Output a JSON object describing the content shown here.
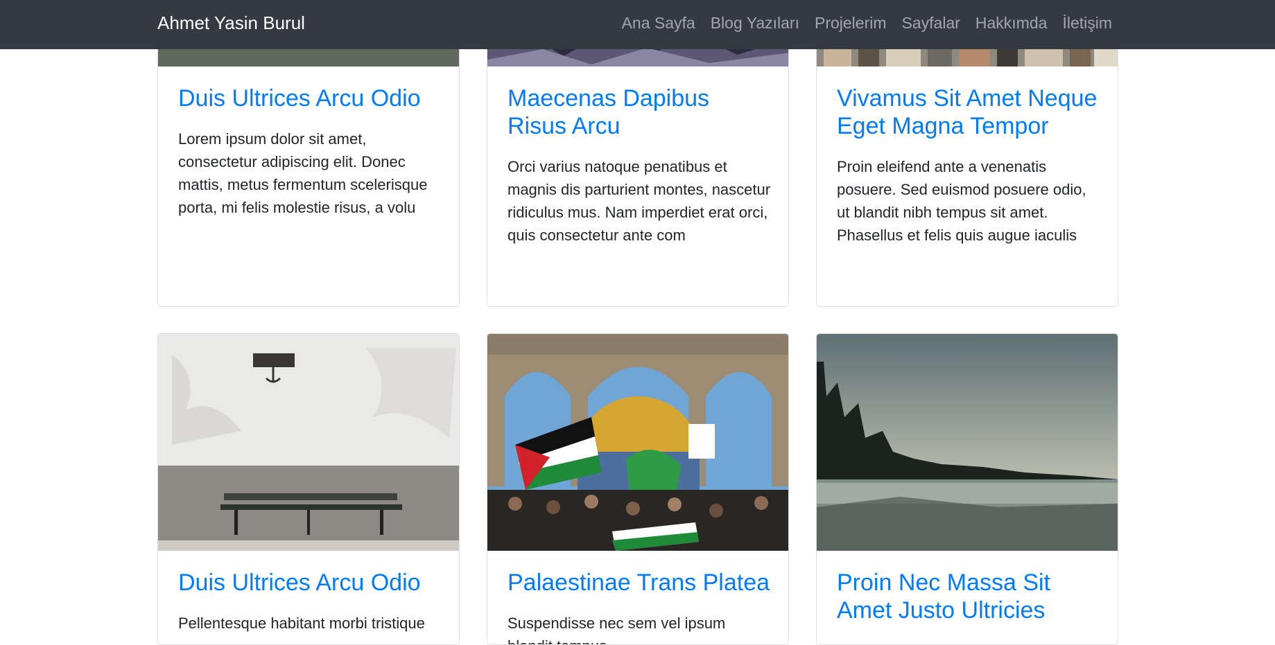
{
  "brand": "Ahmet Yasin Burul",
  "nav": [
    {
      "label": "Ana Sayfa"
    },
    {
      "label": "Blog Yazıları"
    },
    {
      "label": "Projelerim"
    },
    {
      "label": "Sayfalar"
    },
    {
      "label": "Hakkımda"
    },
    {
      "label": "İletişim"
    }
  ],
  "posts": [
    {
      "title": "Duis Ultrices Arcu Odio",
      "excerpt": "Lorem ipsum dolor sit amet, consectetur adipiscing elit. Donec mattis, metus fermentum scelerisque porta, mi felis molestie risus, a volu"
    },
    {
      "title": "Maecenas Dapibus Risus Arcu",
      "excerpt": "Orci varius natoque penatibus et magnis dis parturient montes, nascetur ridiculus mus. Nam imperdiet erat orci, quis consectetur ante com"
    },
    {
      "title": "Vivamus Sit Amet Neque Eget Magna Tempor",
      "excerpt": "Proin eleifend ante a venenatis posuere. Sed euismod posuere odio, ut blandit nibh tempus sit amet. Phasellus et felis quis augue iaculis"
    },
    {
      "title": "Duis Ultrices Arcu Odio",
      "excerpt": "Pellentesque habitant morbi tristique"
    },
    {
      "title": "Palaestinae Trans Platea",
      "excerpt": "Suspendisse nec sem vel ipsum blandit tempus"
    },
    {
      "title": "Proin Nec Massa Sit Amet Justo Ultricies",
      "excerpt": ""
    }
  ]
}
